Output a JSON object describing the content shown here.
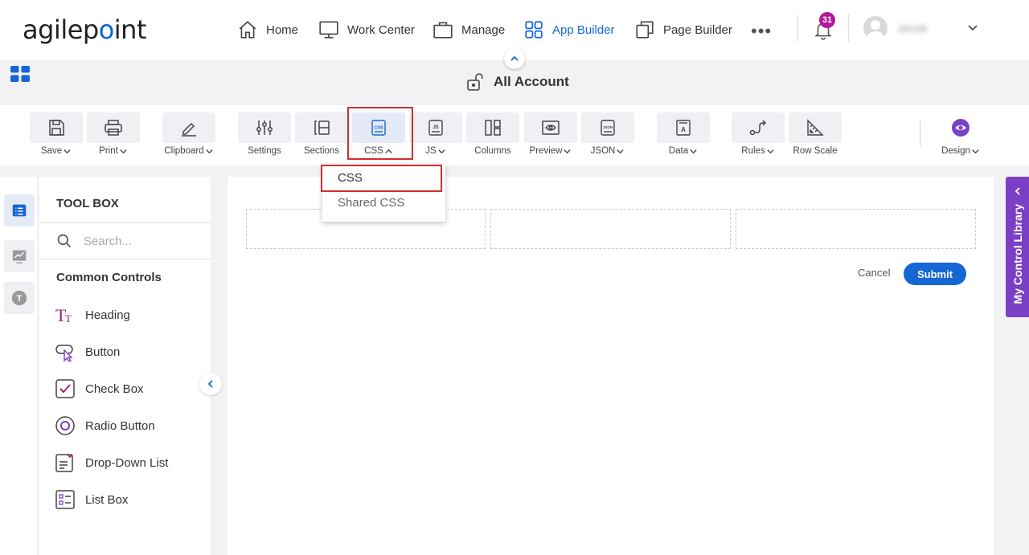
{
  "nav": {
    "logo_prefix": "agilep",
    "logo_mark": "o",
    "logo_suffix": "int",
    "items": [
      {
        "label": "Home",
        "icon": "home-icon"
      },
      {
        "label": "Work Center",
        "icon": "monitor-icon"
      },
      {
        "label": "Manage",
        "icon": "briefcase-icon"
      },
      {
        "label": "App Builder",
        "icon": "grid-icon",
        "active": true
      },
      {
        "label": "Page Builder",
        "icon": "pages-icon"
      }
    ],
    "more": "•••",
    "notification_count": "31",
    "user_name": "Jecob",
    "accent_color": "#1467d4",
    "badge_color": "#b0199c"
  },
  "page": {
    "title": "All Account"
  },
  "toolbar": {
    "save": "Save",
    "print": "Print",
    "clipboard": "Clipboard",
    "settings": "Settings",
    "sections": "Sections",
    "css": "CSS",
    "js": "JS",
    "columns": "Columns",
    "preview": "Preview",
    "json": "JSON",
    "data": "Data",
    "rules": "Rules",
    "row_scale": "Row Scale",
    "design": "Design"
  },
  "css_menu": {
    "items": [
      "CSS",
      "Shared CSS"
    ],
    "selected": "CSS",
    "highlight_color": "#d32d2d"
  },
  "toolbox": {
    "title": "TOOL BOX",
    "search_placeholder": "Search...",
    "category": "Common Controls",
    "controls": [
      "Heading",
      "Button",
      "Check Box",
      "Radio Button",
      "Drop-Down List",
      "List Box"
    ]
  },
  "form": {
    "cancel": "Cancel",
    "submit": "Submit"
  },
  "control_library": {
    "label": "My Control Library",
    "color": "#7b3fc6"
  }
}
